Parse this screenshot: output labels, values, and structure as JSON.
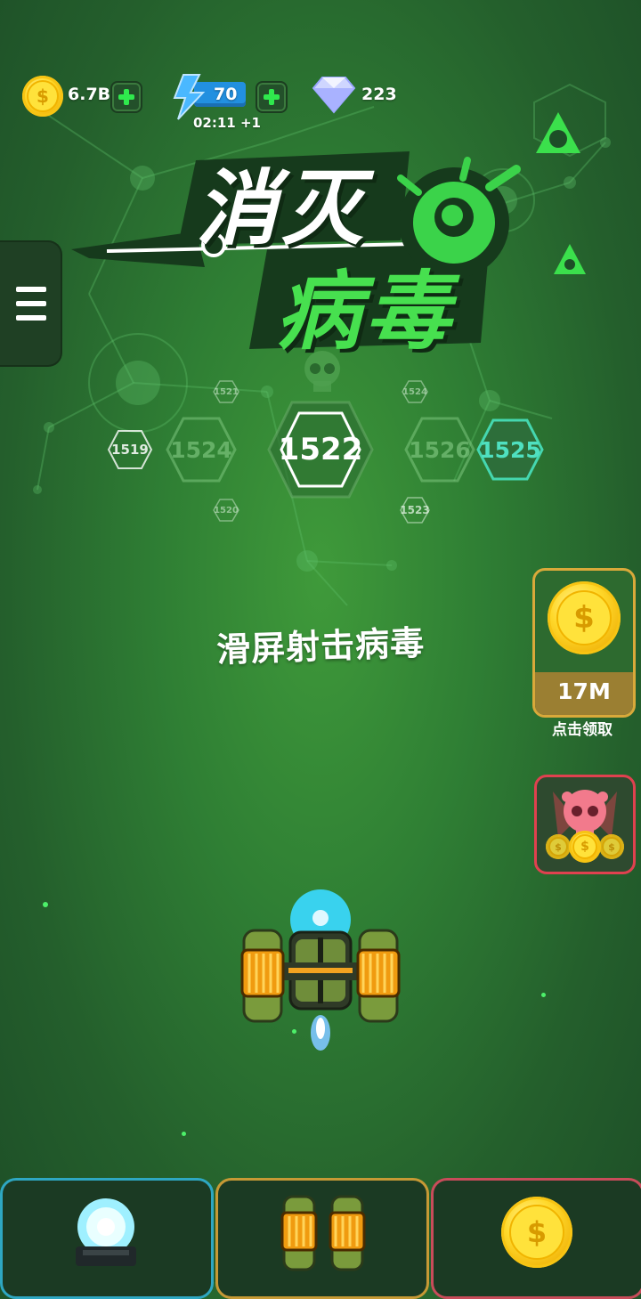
{
  "resources": {
    "coins": "6.7B",
    "energy": "70",
    "energy_timer": "02:11 +1",
    "gems": "223"
  },
  "title": {
    "line1": "消灭",
    "line2": "病毒"
  },
  "levels": {
    "current": "1522",
    "left_near": "1524",
    "left_far": "1519",
    "right_near": "1526",
    "right_far": "1525",
    "top_left": "1521",
    "top_right": "1524",
    "bottom_left": "1520",
    "bottom_right": "1523"
  },
  "prompt": "滑屏射击病毒",
  "reward": {
    "amount": "17M",
    "claim_label": "点击领取",
    "coin_symbol": "$"
  },
  "colors": {
    "accent_green": "#2fe94d",
    "tab_cyan": "#2ea7c2",
    "tab_gold": "#c69935",
    "tab_red": "#c84c5a"
  },
  "icons": {
    "coin": "coin-icon",
    "energy": "lightning-icon",
    "gem": "diamond-icon",
    "menu": "hamburger-icon"
  }
}
